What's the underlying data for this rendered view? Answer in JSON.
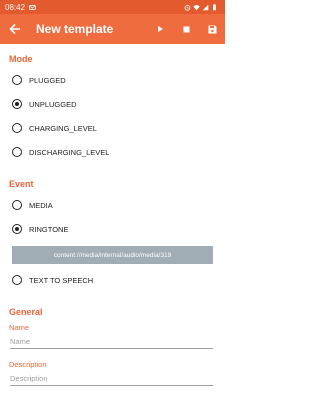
{
  "status_bar": {
    "time": "08:42",
    "icons": [
      "notification-icon",
      "alarm-icon",
      "wifi-icon",
      "signal-icon",
      "battery-icon"
    ]
  },
  "app_bar": {
    "title": "New template",
    "back_icon": "arrow-left-icon",
    "actions": [
      "play-icon",
      "stop-icon",
      "save-icon"
    ],
    "color": "#ef6c3f"
  },
  "mode": {
    "header": "Mode",
    "options": [
      {
        "label": "PLUGGED",
        "selected": false
      },
      {
        "label": "UNPLUGGED",
        "selected": true
      },
      {
        "label": "CHARGING_LEVEL",
        "selected": false
      },
      {
        "label": "DISCHARGING_LEVEL",
        "selected": false
      }
    ]
  },
  "event": {
    "header": "Event",
    "options": [
      {
        "label": "MEDIA",
        "selected": false
      },
      {
        "label": "RINGTONE",
        "selected": true
      },
      {
        "label": "TEXT TO SPEECH",
        "selected": false
      }
    ],
    "ringtone_path": "content://media/internal/audio/media/319"
  },
  "general": {
    "header": "General",
    "name_label": "Name",
    "name_placeholder": "Name",
    "description_label": "Description",
    "description_placeholder": "Description"
  },
  "colors": {
    "accent": "#e8663a",
    "status_bar": "#e35a2e",
    "path_box": "#a0adb4"
  }
}
